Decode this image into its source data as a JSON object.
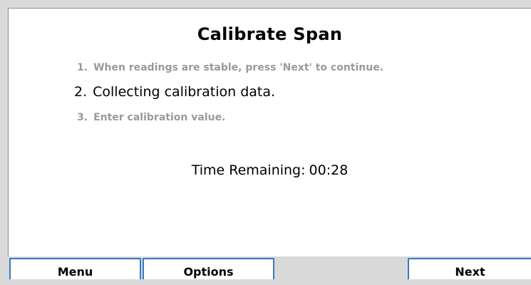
{
  "screen": {
    "title": "Calibrate Span",
    "steps": [
      {
        "number": "1.",
        "text": "When readings are stable, press 'Next' to continue.",
        "state": "inactive"
      },
      {
        "number": "2.",
        "text": "Collecting calibration data.",
        "state": "active"
      },
      {
        "number": "3.",
        "text": "Enter calibration value.",
        "state": "inactive"
      }
    ],
    "timer": {
      "label": "Time Remaining:",
      "value": "00:28"
    }
  },
  "softkeys": {
    "menu_label": "Menu",
    "options_label": "Options",
    "next_label": "Next"
  },
  "colors": {
    "softkey_border": "#3a79c4",
    "inactive_step": "#9a9a9a",
    "background": "#d9d9d9"
  }
}
